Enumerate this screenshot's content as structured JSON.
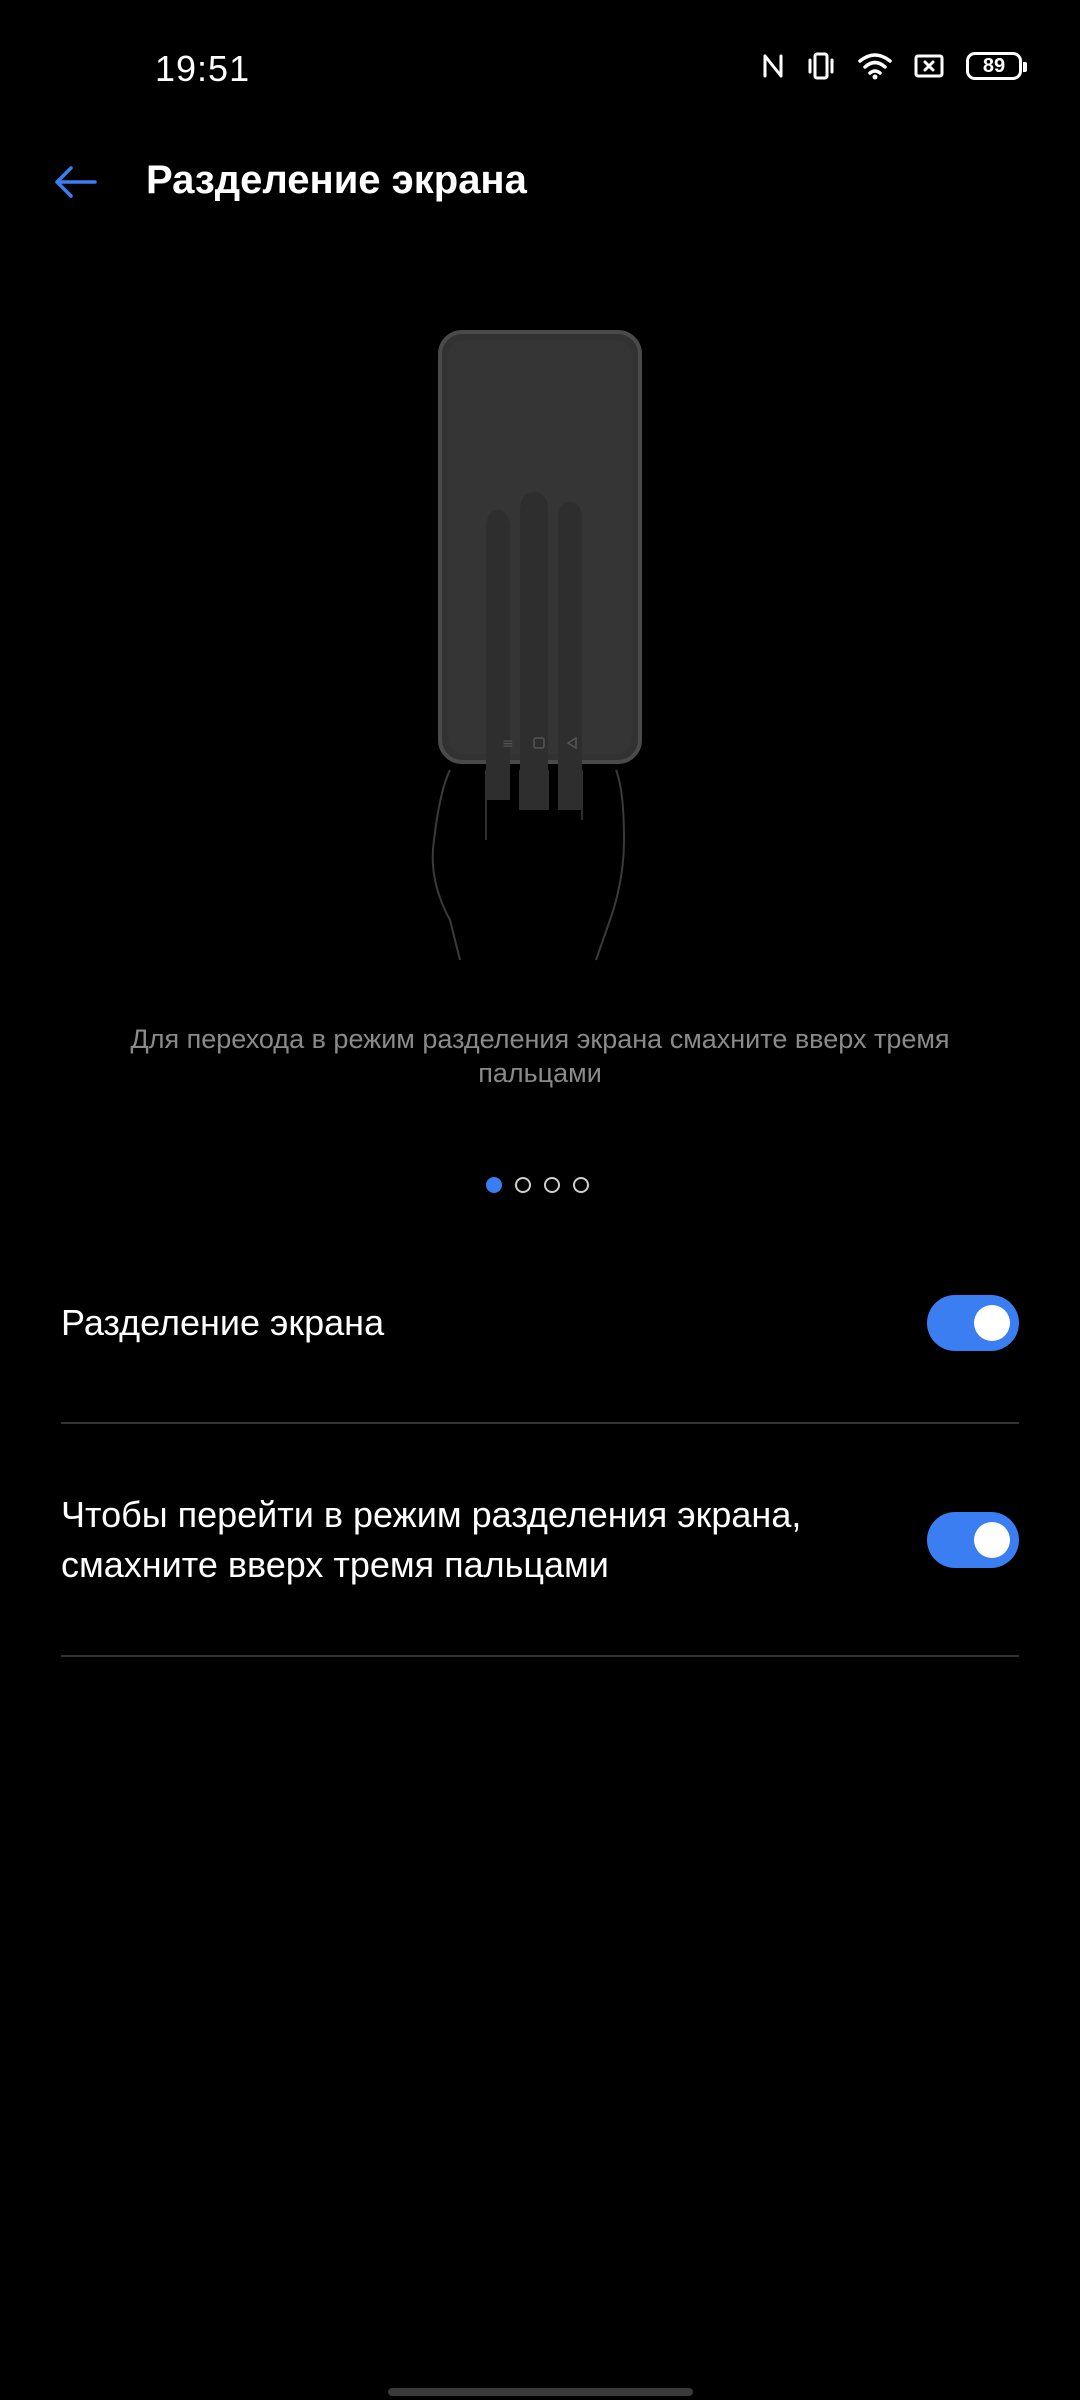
{
  "status_bar": {
    "time": "19:51",
    "battery_level": "89",
    "icons": [
      "nfc-icon",
      "vibrate-icon",
      "wifi-icon",
      "screenshot-icon",
      "battery-icon"
    ]
  },
  "header": {
    "back_icon": "arrow-left-icon",
    "title": "Разделение экрана"
  },
  "illustration": {
    "icon": "three-finger-swipe-hand-icon"
  },
  "description": "Для перехода в режим разделения экрана смахните вверх тремя пальцами",
  "pager": {
    "count": 4,
    "active_index": 0
  },
  "settings": [
    {
      "label": "Разделение экрана",
      "enabled": true
    },
    {
      "label": "Чтобы перейти в режим разделения экрана, смахните вверх тремя пальцами",
      "enabled": true
    }
  ],
  "colors": {
    "background": "#000000",
    "accent": "#3a7ef2",
    "secondary_text": "#8a8a8a",
    "divider": "#333333"
  }
}
